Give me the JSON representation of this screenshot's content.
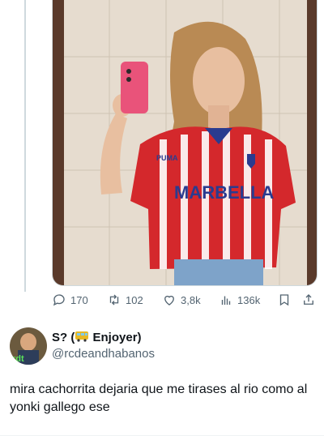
{
  "tweet": {
    "media_caption": "",
    "shirt_text": "MARBELLA",
    "shirt_brand": "PUMA",
    "stats": {
      "replies": "170",
      "retweets": "102",
      "likes": "3,8k",
      "views": "136k"
    }
  },
  "reply": {
    "display_name_part1": "S? (",
    "display_name_part2": " Enjoyer)",
    "display_name_emoji_icon": "bus-icon",
    "handle": "@rcdeandhabanos",
    "avatar_label": "rdt",
    "text": "mira cachorrita dejaria que me tirases al rio como al yonki gallego ese"
  },
  "colors": {
    "accent": "#1d9bf0",
    "secondary_text": "#536471",
    "shirt_red": "#d4282c",
    "shirt_blue": "#2a3b8f"
  }
}
